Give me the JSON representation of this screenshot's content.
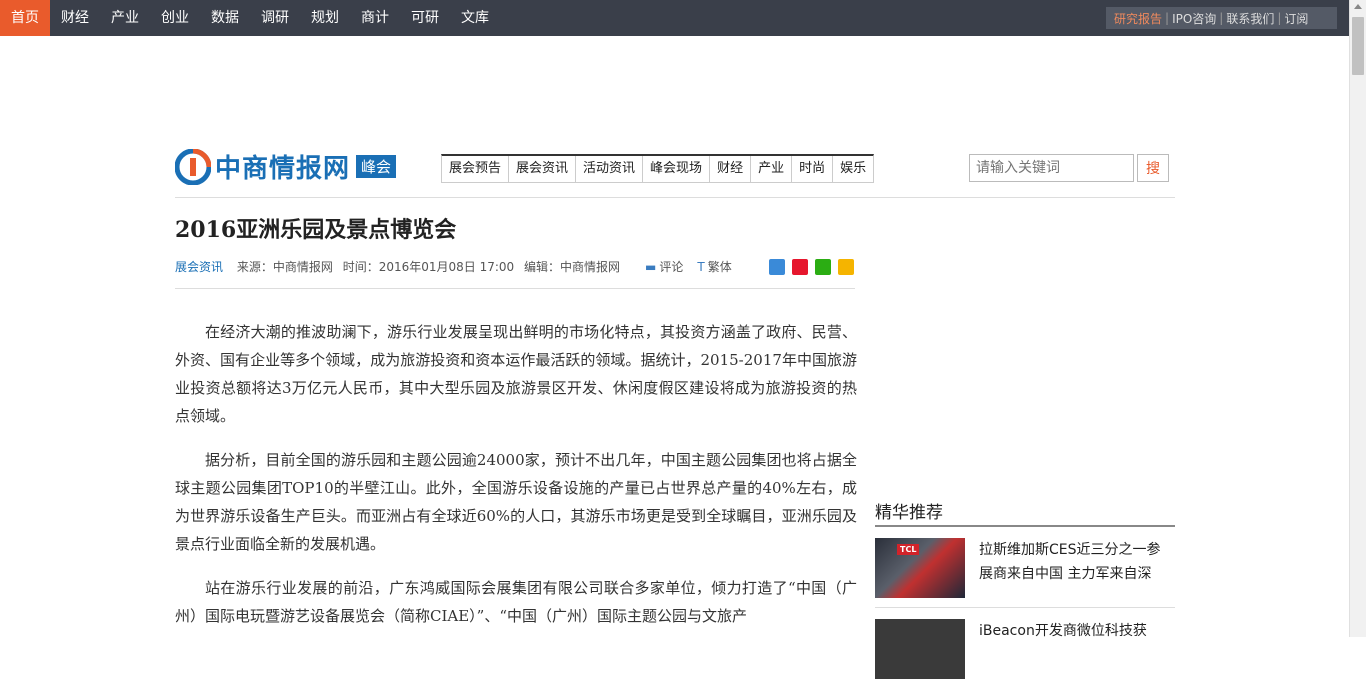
{
  "topnav": {
    "items": [
      "首页",
      "财经",
      "产业",
      "创业",
      "数据",
      "调研",
      "规划",
      "商计",
      "可研",
      "文库"
    ],
    "active_index": 0
  },
  "toplinks": {
    "research": "研究报告",
    "ipo": "IPO咨询",
    "contact": "联系我们",
    "subscribe": "订阅",
    "separator": "|"
  },
  "logo": {
    "name": "中商情报网",
    "badge": "峰会"
  },
  "subnav": {
    "items": [
      "展会预告",
      "展会资讯",
      "活动资讯",
      "峰会现场",
      "财经",
      "产业",
      "时尚",
      "娱乐"
    ]
  },
  "search": {
    "placeholder": "请输入关键词",
    "button": "搜"
  },
  "article": {
    "title": "2016亚洲乐园及景点博览会",
    "category": "展会资讯",
    "source": "来源：中商情报网",
    "time": "时间：2016年01月08日 17:00",
    "editor": "编辑：中商情报网",
    "comment_label": "评论",
    "traditional_label": "繁体",
    "paragraphs": [
      "在经济大潮的推波助澜下，游乐行业发展呈现出鲜明的市场化特点，其投资方涵盖了政府、民营、外资、国有企业等多个领域，成为旅游投资和资本运作最活跃的领域。据统计，2015-2017年中国旅游业投资总额将达3万亿元人民币，其中大型乐园及旅游景区开发、休闲度假区建设将成为旅游投资的热点领域。",
      "据分析，目前全国的游乐园和主题公园逾24000家，预计不出几年，中国主题公园集团也将占据全球主题公园集团TOP10的半壁江山。此外，全国游乐设备设施的产量已占世界总产量的40%左右，成为世界游乐设备生产巨头。而亚洲占有全球近60%的人口，其游乐市场更是受到全球瞩目，亚洲乐园及景点行业面临全新的发展机遇。",
      "站在游乐行业发展的前沿，广东鸿威国际会展集团有限公司联合多家单位，倾力打造了“中国（广州）国际电玩暨游艺设备展览会（简称CIAE）”、“中国（广州）国际主题公园与文旅产"
    ]
  },
  "sidebar": {
    "title": "精华推荐",
    "items": [
      {
        "title": "拉斯维加斯CES近三分之一参展商来自中国 主力军来自深",
        "thumb_label": "TCL"
      },
      {
        "title": "iBeacon开发商微位科技获",
        "thumb_label": ""
      }
    ]
  },
  "colors": {
    "topbar": "#3a3f4a",
    "accent": "#e95b2c",
    "brand": "#1a6fb5"
  }
}
